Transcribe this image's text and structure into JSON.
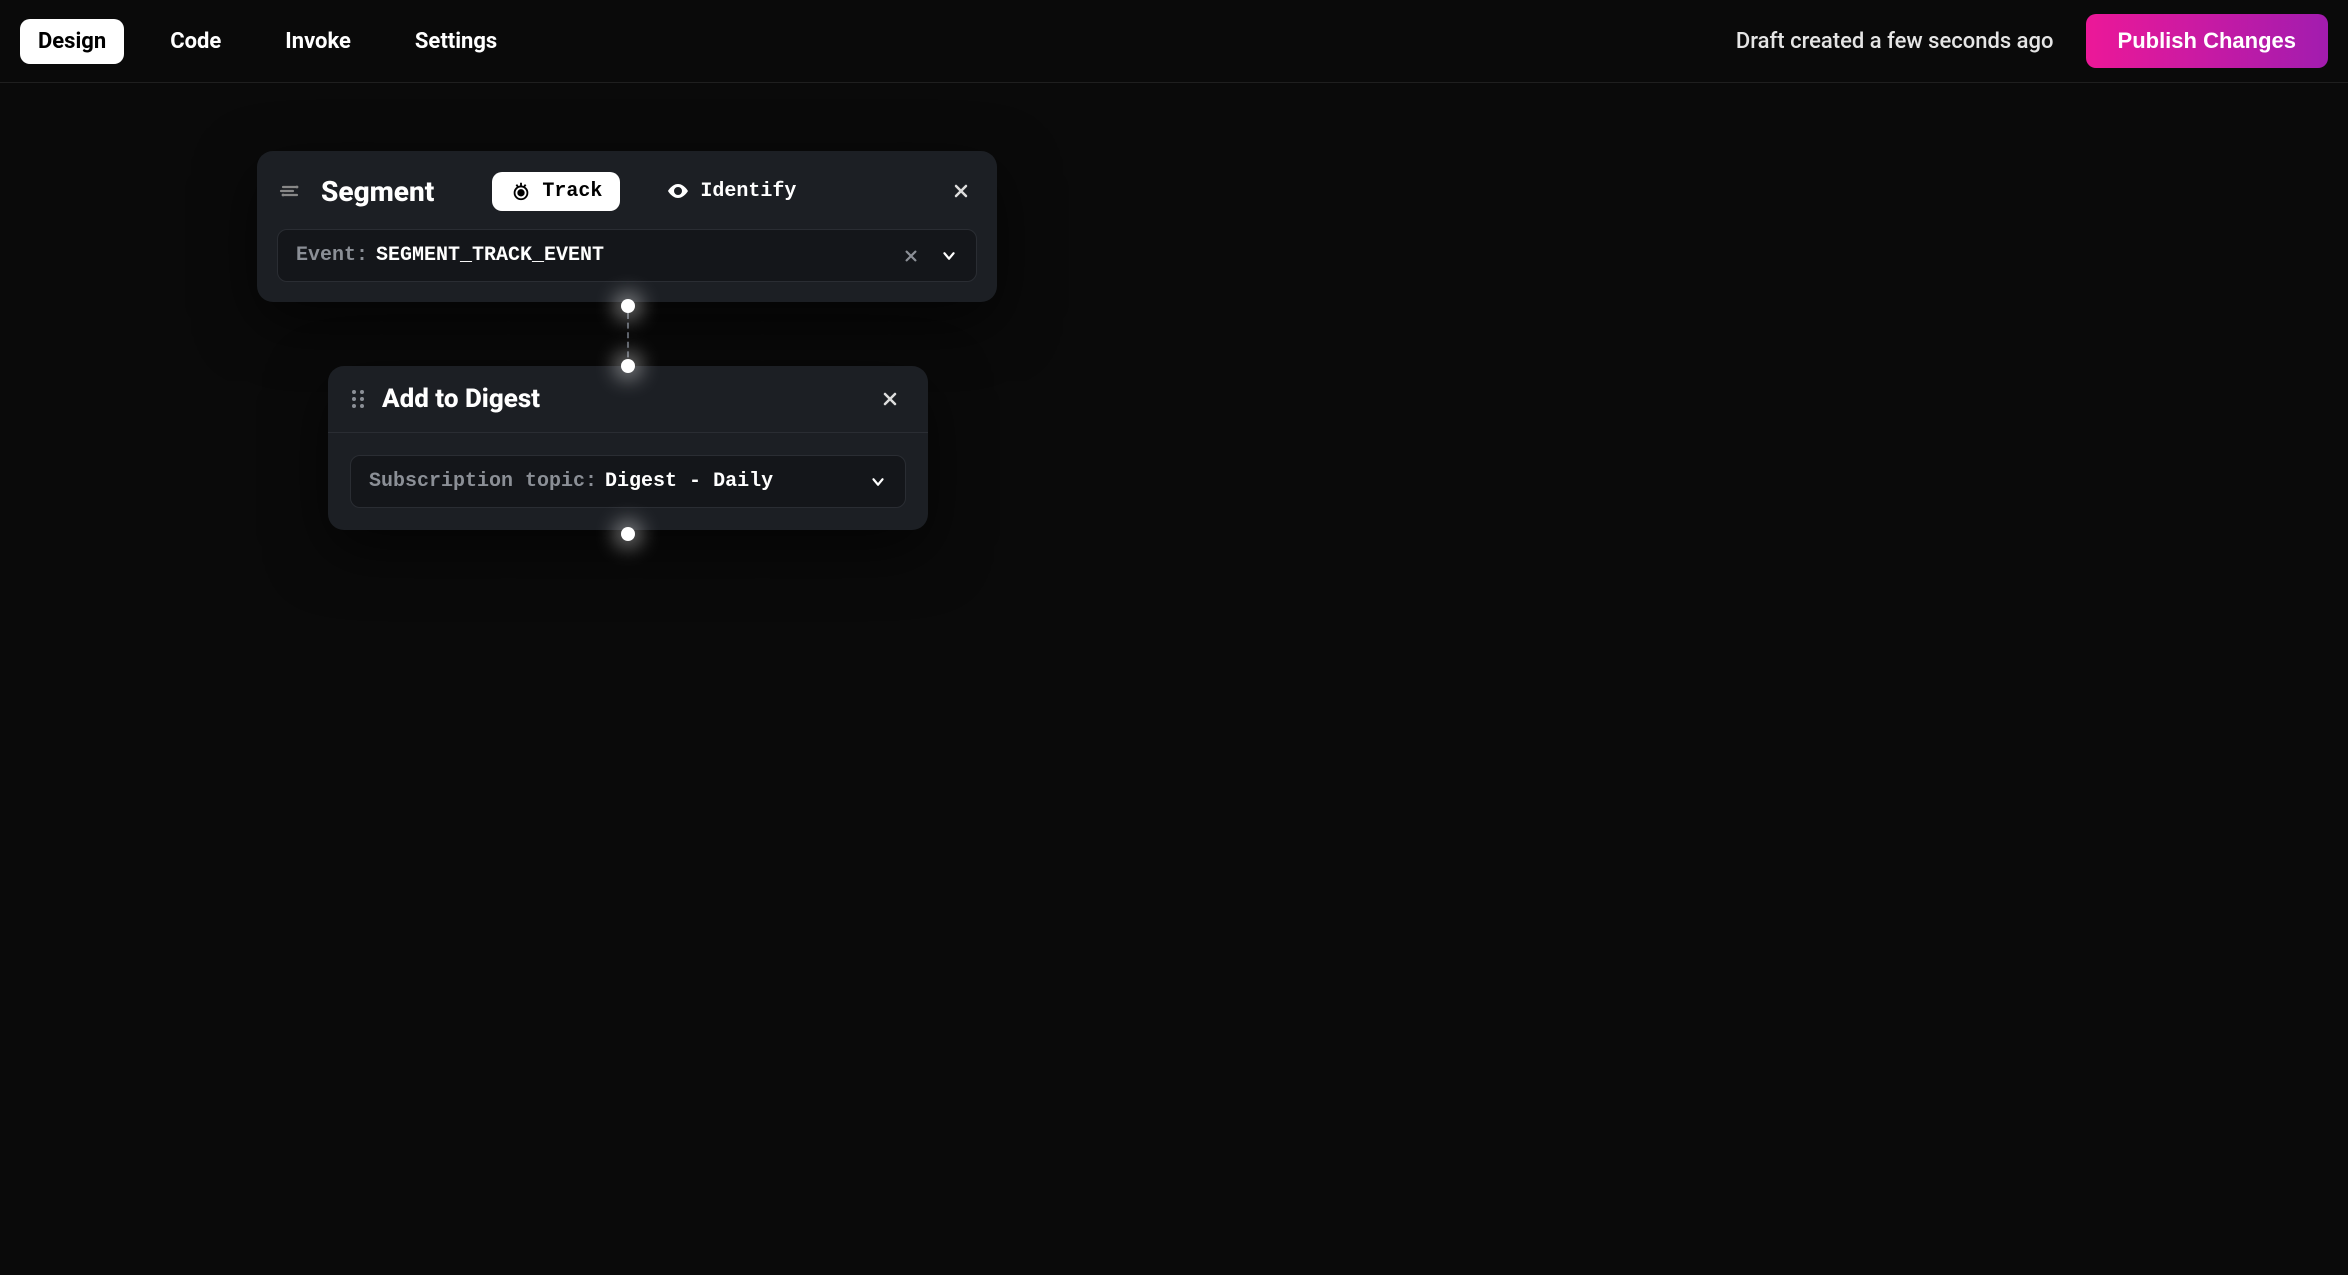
{
  "header": {
    "tabs": [
      "Design",
      "Code",
      "Invoke",
      "Settings"
    ],
    "active_tab": "Design",
    "draft_status": "Draft created a few seconds ago",
    "publish_label": "Publish Changes"
  },
  "segment_node": {
    "title": "Segment",
    "toggle": {
      "track_label": "Track",
      "identify_label": "Identify",
      "active": "Track"
    },
    "event": {
      "label": "Event:",
      "value": "SEGMENT_TRACK_EVENT"
    }
  },
  "digest_node": {
    "title": "Add to Digest",
    "field": {
      "label": "Subscription topic:",
      "value": "Digest - Daily"
    }
  }
}
